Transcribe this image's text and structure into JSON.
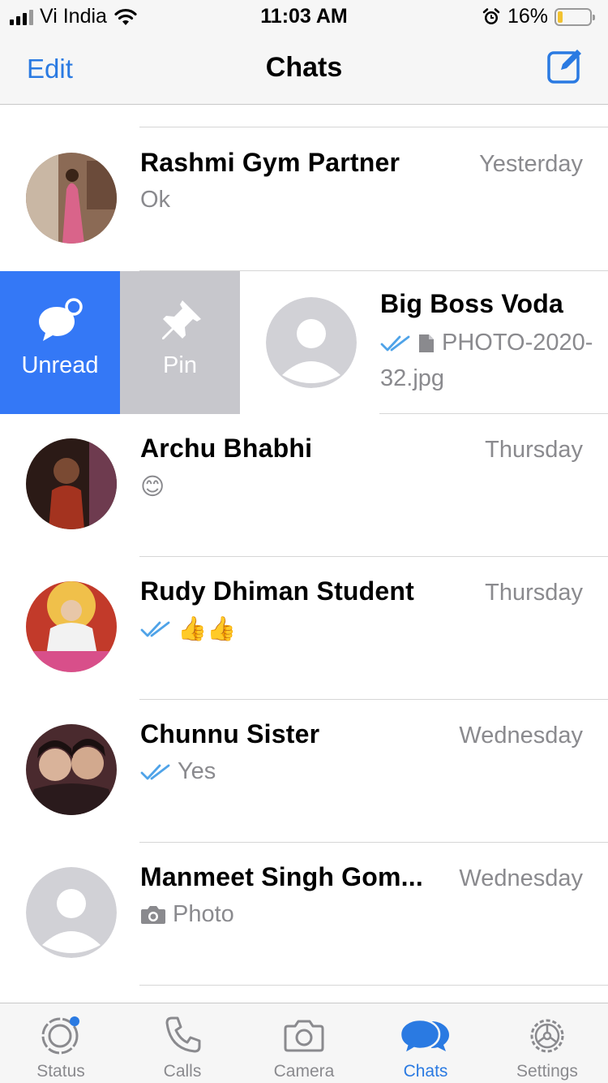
{
  "status_bar": {
    "carrier": "Vi India",
    "time": "11:03 AM",
    "battery_percent": "16%",
    "battery_level": 0.16
  },
  "nav": {
    "edit_label": "Edit",
    "title": "Chats",
    "compose_icon": "compose-icon"
  },
  "chats": [
    {
      "name": "Rashmi Gym Partner",
      "time": "Yesterday",
      "preview": "Ok",
      "read_ticks": false
    },
    {
      "name": "Big Boss Voda",
      "time": "",
      "preview_line1": "PHOTO-2020-",
      "preview_line2": "32.jpg",
      "read_ticks": true,
      "attachment_icon": "document-icon"
    },
    {
      "name": "Archu Bhabhi",
      "time": "Thursday",
      "preview": "😊",
      "read_ticks": false
    },
    {
      "name": "Rudy Dhiman Student",
      "time": "Thursday",
      "preview": "👍👍",
      "read_ticks": true
    },
    {
      "name": "Chunnu Sister",
      "time": "Wednesday",
      "preview": "Yes",
      "read_ticks": true
    },
    {
      "name": "Manmeet Singh Gom...",
      "time": "Wednesday",
      "preview": "Photo",
      "read_ticks": false,
      "attachment_icon": "camera-icon"
    }
  ],
  "swipe_actions": {
    "unread_label": "Unread",
    "pin_label": "Pin"
  },
  "tabbar": {
    "tabs": [
      {
        "label": "Status",
        "icon": "status-icon",
        "active": false
      },
      {
        "label": "Calls",
        "icon": "phone-icon",
        "active": false
      },
      {
        "label": "Camera",
        "icon": "camera-icon",
        "active": false
      },
      {
        "label": "Chats",
        "icon": "chats-icon",
        "active": true
      },
      {
        "label": "Settings",
        "icon": "gear-icon",
        "active": false
      }
    ]
  },
  "colors": {
    "accent": "#2a7ae2",
    "unread_action": "#3478f6",
    "pin_action": "#c7c7cc",
    "secondary_text": "#8a8a8e"
  }
}
